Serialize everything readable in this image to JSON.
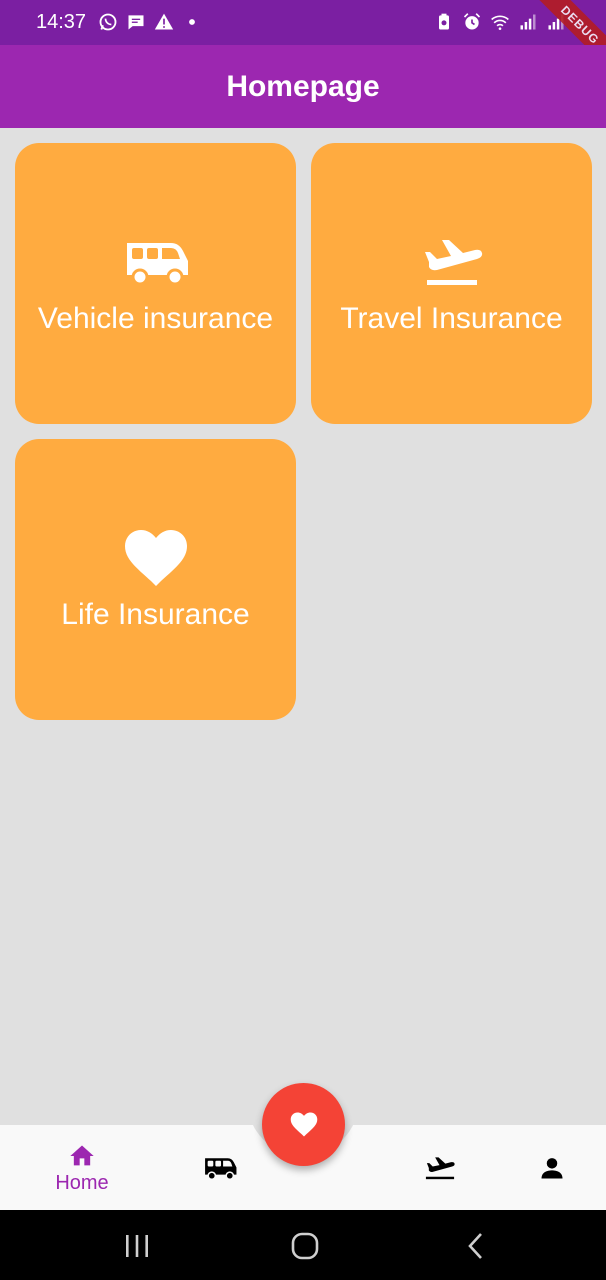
{
  "status_bar": {
    "time": "14:37",
    "left_icons": [
      "whatsapp-icon",
      "message-icon",
      "warning-icon",
      "dot-icon"
    ],
    "right_icons": [
      "battery-saver-icon",
      "alarm-icon",
      "wifi-icon",
      "signal-icon",
      "signal-icon"
    ],
    "debug_label": "DEBUG"
  },
  "app_bar": {
    "title": "Homepage"
  },
  "cards": [
    {
      "label": "Vehicle insurance",
      "icon": "van-icon"
    },
    {
      "label": "Travel Insurance",
      "icon": "flight-takeoff-icon"
    },
    {
      "label": "Life Insurance",
      "icon": "heart-icon"
    }
  ],
  "bottom_nav": {
    "items": [
      {
        "label": "Home",
        "icon": "home-icon",
        "active": true
      },
      {
        "label": "",
        "icon": "van-icon",
        "active": false
      },
      {
        "label": "",
        "icon": "flight-takeoff-icon",
        "active": false
      },
      {
        "label": "",
        "icon": "person-icon",
        "active": false
      }
    ],
    "fab_icon": "heart-icon"
  },
  "system_nav": {
    "buttons": [
      "recents-icon",
      "home-circle-icon",
      "back-icon"
    ]
  },
  "colors": {
    "status_bar": "#7b1fa2",
    "app_bar": "#9c27b0",
    "card": "#ffab40",
    "background": "#e0e0e0",
    "fab": "#f44336",
    "active_nav": "#9c27b0"
  }
}
